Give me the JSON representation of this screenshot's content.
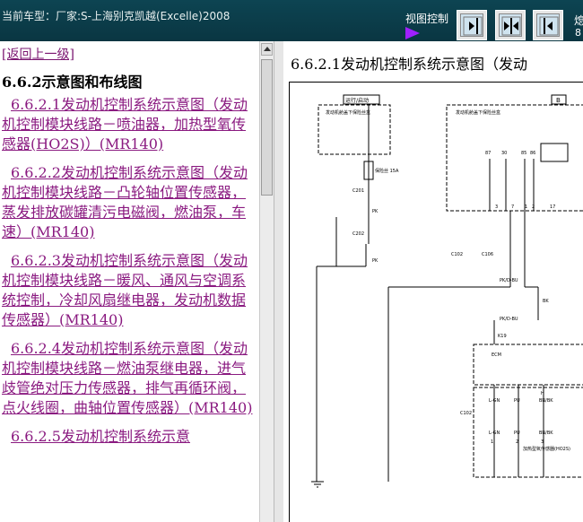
{
  "header": {
    "vehicle_text": "当前车型：厂家:S-上海别克凯越(Excelle)2008",
    "view_control_label": "视图控制",
    "corner_top": "熄",
    "corner_bottom": "8"
  },
  "view_buttons": [
    {
      "icon": "collapse-left-icon"
    },
    {
      "icon": "split-view-icon"
    },
    {
      "icon": "expand-left-icon"
    }
  ],
  "sidebar": {
    "back_link": "[返回上一级]",
    "section_title": "6.6.2示意图和布线图",
    "items": [
      {
        "label": "6.6.2.1发动机控制系统示意图（发动机控制模块线路－喷油器，加热型氧传感器(HO2S)）(MR140)"
      },
      {
        "label": "6.6.2.2发动机控制系统示意图（发动机控制模块线路－凸轮轴位置传感器，蒸发排放碳罐清污电磁阀，燃油泵，车速）(MR140)"
      },
      {
        "label": "6.6.2.3发动机控制系统示意图（发动机控制模块线路－暖风、通风与空调系统控制，冷却风扇继电器，发动机数据传感器）(MR140)"
      },
      {
        "label": "6.6.2.4发动机控制系统示意图（发动机控制模块线路－燃油泵继电器，进气歧管绝对压力传感器，排气再循环阀，点火线圈，曲轴位置传感器）(MR140)"
      },
      {
        "label": "6.6.2.5发动机控制系统示意"
      }
    ]
  },
  "content": {
    "title": "6.6.2.1发动机控制系统示意图（发动",
    "diagram": {
      "label_run_start": "运行/启动",
      "label_b": "B",
      "label_fuse_box": "发动机舱盖下保险丝盒",
      "label_fuse": "保险丝 15A",
      "label_relay_box": "发动机舱盖下保险丝盒",
      "label_c201": "C201",
      "label_c202": "C202",
      "label_pk1": "PK",
      "label_pk2": "PK",
      "label_c102": "C102",
      "label_c106": "C106",
      "label_pkdbu1": "PK/D-BU",
      "label_pkdbu2": "PK/D-BU",
      "label_bk": "BK",
      "label_k19": "K19",
      "label_ecm": "ECM",
      "label_c102b": "C102",
      "pin_labels": [
        "87",
        "30",
        "85",
        "86",
        "3",
        "7",
        "1",
        "2",
        "17",
        "H",
        "1",
        "2",
        "3"
      ],
      "wire_labels": [
        "L-GN",
        "PU",
        "BN/BK",
        "L-GN",
        "PU",
        "BN/BK"
      ],
      "label_o2": "加热型氧传感器(HO2S)"
    }
  }
}
